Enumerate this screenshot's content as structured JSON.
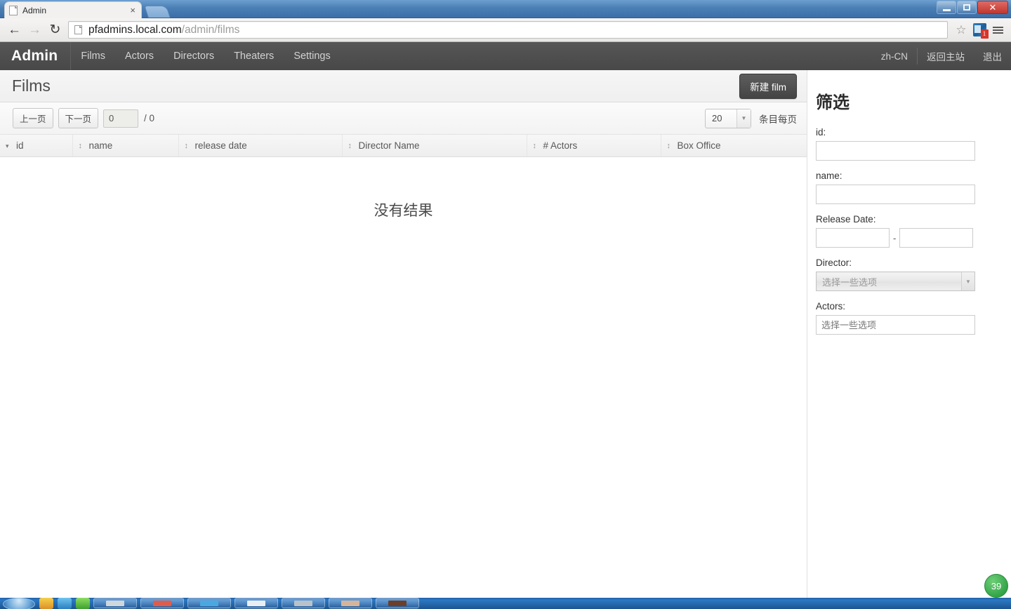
{
  "browser": {
    "tab": {
      "title": "Admin",
      "favicon": "page-icon",
      "close_label": "×"
    },
    "url_host": "pfadmins.local.com",
    "url_path": "/admin/films",
    "back_icon": "←",
    "forward_icon": "→",
    "reload_icon": "↻",
    "star_icon": "☆",
    "extension_badge": "1",
    "window": {
      "minimize": "minimize-icon",
      "maximize": "maximize-icon",
      "close": "✕"
    }
  },
  "appnav": {
    "brand": "Admin",
    "links": [
      {
        "label": "Films"
      },
      {
        "label": "Actors"
      },
      {
        "label": "Directors"
      },
      {
        "label": "Theaters"
      },
      {
        "label": "Settings"
      }
    ],
    "right_links": [
      {
        "label": "zh-CN"
      },
      {
        "label": "返回主站"
      },
      {
        "label": "退出"
      }
    ]
  },
  "page": {
    "title": "Films",
    "new_button": "新建 film"
  },
  "list_toolbar": {
    "prev_label": "上一页",
    "next_label": "下一页",
    "page_value": "0",
    "page_total": "/ 0",
    "per_page_value": "20",
    "per_page_options": [
      "20"
    ],
    "per_page_label": "条目每页",
    "arrow_icon": "▼"
  },
  "table": {
    "columns": [
      {
        "label": "id",
        "sort": "active"
      },
      {
        "label": "name",
        "sort": "updown"
      },
      {
        "label": "release date",
        "sort": "updown"
      },
      {
        "label": "Director Name",
        "sort": "updown"
      },
      {
        "label": "# Actors",
        "sort": "updown"
      },
      {
        "label": "Box Office",
        "sort": "updown"
      }
    ],
    "rows": [],
    "empty_message": "没有结果"
  },
  "filters": {
    "title": "筛选",
    "id": {
      "label": "id:",
      "value": "",
      "placeholder": ""
    },
    "name": {
      "label": "name:",
      "value": "",
      "placeholder": ""
    },
    "release_date": {
      "label": "Release Date:",
      "from_value": "",
      "to_value": "",
      "separator": "-"
    },
    "director": {
      "label": "Director:",
      "placeholder": "选择一些选项",
      "value": "",
      "arrow_icon": "▼"
    },
    "actors": {
      "label": "Actors:",
      "placeholder": "选择一些选项",
      "value": ""
    }
  },
  "overlay": {
    "zoom_badge": "39"
  },
  "taskbar": {
    "clock": ""
  },
  "colors": {
    "navbar_bg": "#4f4f4f",
    "accent_blue": "#3c6ea8",
    "button_dark": "#4d4d4d",
    "badge_green": "#34a548",
    "badge_red": "#d8342a"
  }
}
